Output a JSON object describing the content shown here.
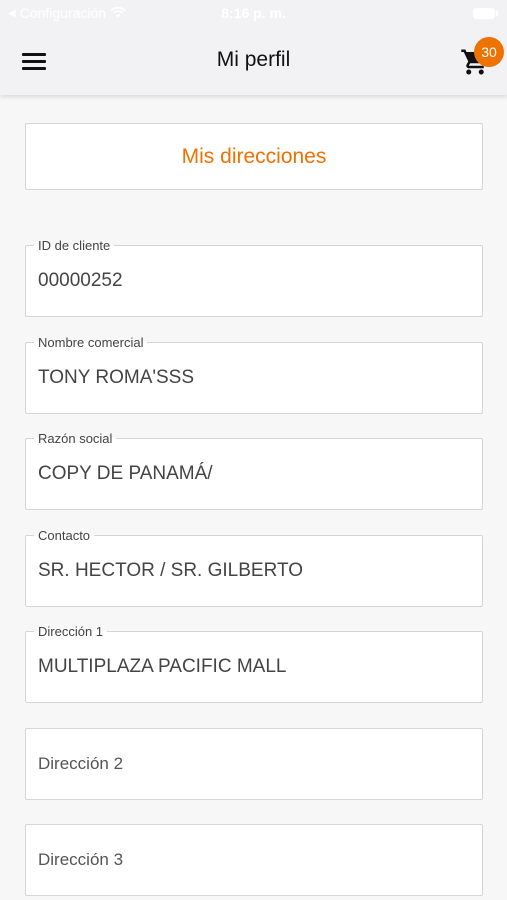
{
  "status_bar": {
    "back_label": "Configuración",
    "time": "8:16 p. m."
  },
  "header": {
    "title": "Mi perfil",
    "cart_count": "30"
  },
  "addresses_button": "Mis direcciones",
  "fields": [
    {
      "label": "ID de cliente",
      "value": "00000252"
    },
    {
      "label": "Nombre comercial",
      "value": "TONY ROMA'SSS"
    },
    {
      "label": "Razón social",
      "value": "COPY DE PANAMÁ/"
    },
    {
      "label": "Contacto",
      "value": "SR. HECTOR / SR. GILBERTO"
    },
    {
      "label": "Dirección 1",
      "value": "MULTIPLAZA PACIFIC MALL"
    }
  ],
  "empty_fields": [
    {
      "placeholder": "Dirección 2"
    },
    {
      "placeholder": "Dirección 3"
    }
  ],
  "colors": {
    "accent": "#ee7200",
    "border": "#d6d6d6",
    "background": "#f7f7f7"
  }
}
